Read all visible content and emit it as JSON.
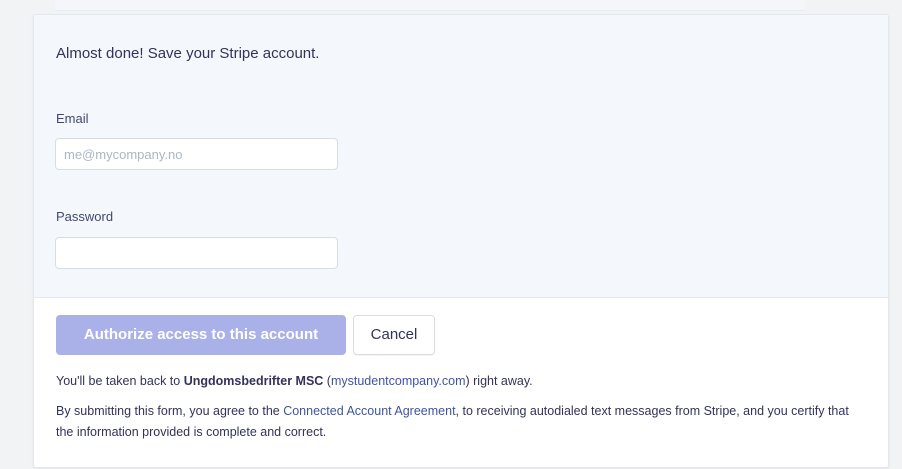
{
  "form": {
    "heading": "Almost done! Save your Stripe account.",
    "email_label": "Email",
    "email_placeholder": "me@mycompany.no",
    "email_value": "",
    "password_label": "Password",
    "password_value": ""
  },
  "actions": {
    "authorize_label": "Authorize access to this account",
    "cancel_label": "Cancel"
  },
  "return_note": {
    "prefix": "You'll be taken back to ",
    "platform_name": "Ungdomsbedrifter MSC",
    "open_paren": " (",
    "platform_url": "mystudentcompany.com",
    "suffix": ") right away."
  },
  "terms_note": {
    "prefix": "By submitting this form, you agree to the ",
    "agreement_link": "Connected Account Agreement",
    "suffix": ", to receiving autodialed text messages from Stripe, and you certify that the information provided is complete and correct."
  },
  "colors": {
    "authorize_button_disabled": "#aab1e8",
    "link": "#3d54a6",
    "form_background": "#f4f8fc"
  }
}
